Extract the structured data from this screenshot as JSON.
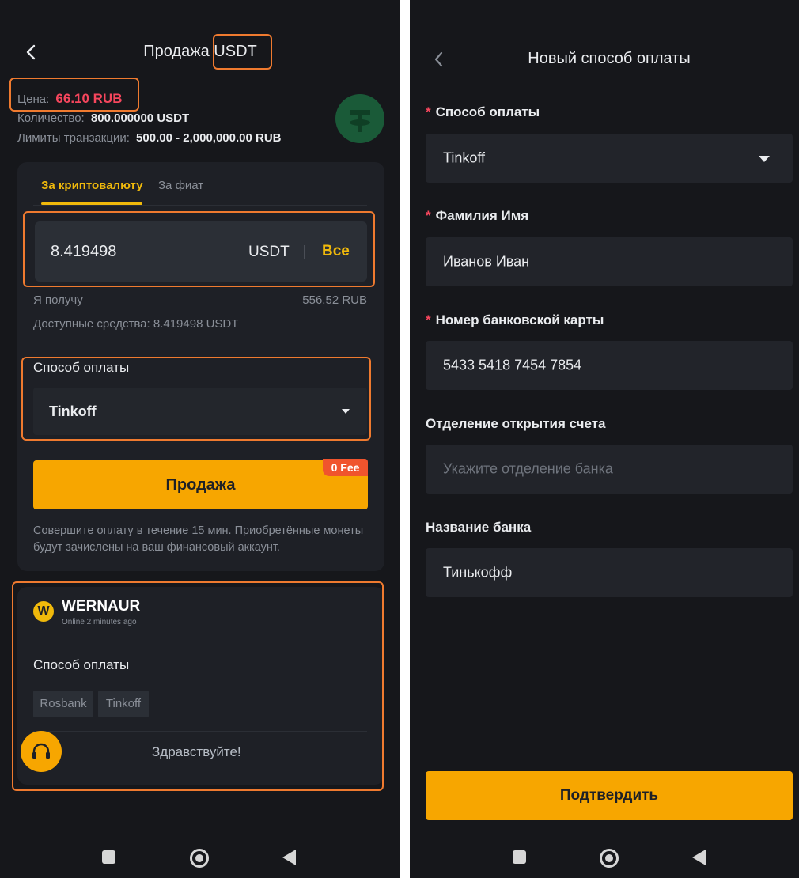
{
  "left": {
    "header": {
      "title": "Продажа",
      "asset": "USDT"
    },
    "info": {
      "price_label": "Цена:",
      "price_value": "66.10 RUB",
      "qty_label": "Количество:",
      "qty_value": "800.000000 USDT",
      "limits_label": "Лимиты транзакции:",
      "limits_value": "500.00 - 2,000,000.00 RUB"
    },
    "tabs": [
      "За криптовалюту",
      "За фиат"
    ],
    "amount": {
      "value": "8.419498",
      "currency": "USDT",
      "all_label": "Все"
    },
    "receive": {
      "label": "Я получу",
      "value": "556.52 RUB"
    },
    "available": "Доступные средства: 8.419498 USDT",
    "payment": {
      "label": "Способ оплаты",
      "selected": "Tinkoff"
    },
    "sell_button": "Продажа",
    "fee_badge": "0 Fee",
    "note": "Совершите оплату в течение 15 мин. Приобретённые монеты будут зачислены на ваш финансовый аккаунт.",
    "seller": {
      "initial": "W",
      "name": "WERNAUR",
      "status": "Online 2 minutes ago",
      "methods_label": "Способ оплаты",
      "methods": [
        "Rosbank",
        "Tinkoff"
      ],
      "greeting": "Здравствуйте!"
    }
  },
  "right": {
    "header": {
      "title": "Новый способ оплаты"
    },
    "fields": {
      "method": {
        "label": "Способ оплаты",
        "value": "Tinkoff"
      },
      "name": {
        "label": "Фамилия Имя",
        "value": "Иванов Иван"
      },
      "card": {
        "label": "Номер банковской карты",
        "value": "5433 5418 7454 7854"
      },
      "branch": {
        "label": "Отделение открытия счета",
        "placeholder": "Укажите отделение банка"
      },
      "bank": {
        "label": "Название банка",
        "value": "Тинькофф"
      }
    },
    "confirm_button": "Подтвердить"
  },
  "colors": {
    "accent": "#f7a600",
    "price": "#f6465d",
    "highlight": "#ef7a2f",
    "background": "#16171b",
    "tether": "#1a7a4a"
  },
  "icons": [
    "back-arrow-icon",
    "tether-icon",
    "dropdown-caret-icon",
    "headset-icon",
    "nav-square-icon",
    "nav-home-icon",
    "nav-back-icon"
  ]
}
